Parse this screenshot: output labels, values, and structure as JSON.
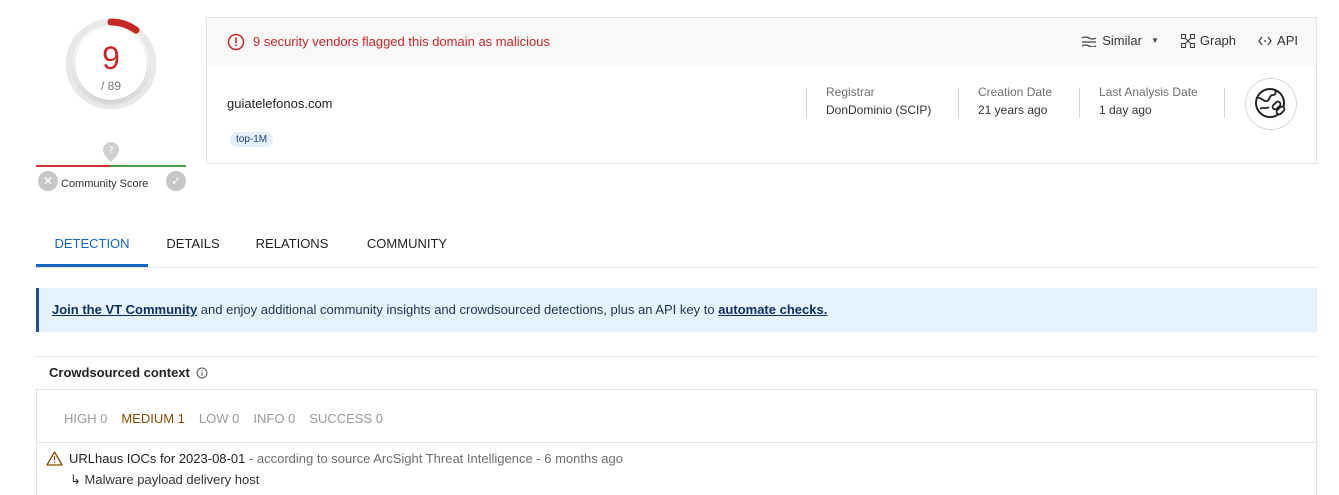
{
  "score": {
    "detections": "9",
    "total": "/ 89",
    "community_label": "Community Score",
    "detection_ratio": 0.101
  },
  "alert": {
    "text": "9 security vendors flagged this domain as malicious",
    "color": "#c62828"
  },
  "toolbar": {
    "similar_label": "Similar",
    "graph_label": "Graph",
    "api_label": "API"
  },
  "domain": {
    "name": "guiatelefonos.com",
    "tag": "top-1M"
  },
  "meta": [
    {
      "label": "Registrar",
      "value": "DonDominio (SCIP)"
    },
    {
      "label": "Creation Date",
      "value": "21 years ago"
    },
    {
      "label": "Last Analysis Date",
      "value": "1 day ago"
    }
  ],
  "tabs": [
    {
      "label": "DETECTION",
      "active": true
    },
    {
      "label": "DETAILS",
      "active": false
    },
    {
      "label": "RELATIONS",
      "active": false
    },
    {
      "label": "COMMUNITY",
      "active": false
    }
  ],
  "banner": {
    "link1": "Join the VT Community",
    "middle": " and enjoy additional community insights and crowdsourced detections, plus an API key to ",
    "link2": "automate checks."
  },
  "crowdsourced": {
    "title": "Crowdsourced context",
    "filters": [
      "HIGH 0",
      "MEDIUM 1",
      "LOW 0",
      "INFO 0",
      "SUCCESS 0"
    ],
    "item": {
      "title": "URLhaus IOCs for 2023-08-01",
      "source": " - according to source ArcSight Threat Intelligence - 6 months ago",
      "sub": "↳ Malware payload delivery host"
    }
  },
  "colors": {
    "accent": "#1565c0",
    "malicious": "#c62828",
    "medium": "#8a4b00"
  }
}
